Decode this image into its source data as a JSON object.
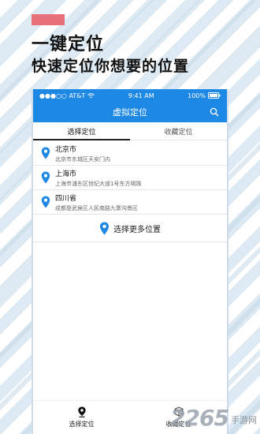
{
  "promo": {
    "title": "一键定位",
    "subtitle": "快速定位你想要的位置"
  },
  "statusbar": {
    "carrier": "●●●○○ AT&T",
    "time": "9:41 AM",
    "battery": "100%"
  },
  "navbar": {
    "title": "虚拟定位"
  },
  "tabs": [
    {
      "label": "选择定位",
      "active": true
    },
    {
      "label": "收藏定位",
      "active": false
    }
  ],
  "locations": [
    {
      "name": "北京市",
      "address": "北京市东城区天安门内"
    },
    {
      "name": "上海市",
      "address": "上海市浦东区世纪大道1号东方明珠"
    },
    {
      "name": "四川省",
      "address": "成都是武侯区人民南路九寨沟景区"
    }
  ],
  "more_button": "选择更多位置",
  "bottom_tabs": [
    {
      "label": "选择定位"
    },
    {
      "label": "收藏定位"
    }
  ],
  "watermark": {
    "number": "2265",
    "text": "手游网"
  },
  "colors": {
    "accent": "#1e88e5",
    "promo_bar": "#e8707a",
    "stripe": "#dde9f3"
  }
}
